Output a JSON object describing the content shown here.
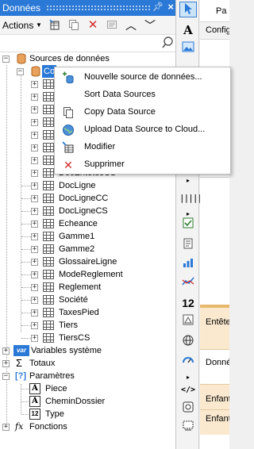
{
  "panel": {
    "title": "Données",
    "pin_icon": "pin-icon",
    "close_icon": "close-icon",
    "toolbar": {
      "actions_label": "Actions",
      "dropdown_icon": "caret-down-icon",
      "icons": [
        "new-datasource-icon",
        "copy-icon",
        "delete-icon",
        "properties-icon",
        "chevron-up-icon",
        "chevron-down-icon"
      ]
    },
    "search": {
      "value": "",
      "placeholder": ""
    },
    "tree": {
      "root": "Sources de données",
      "selected_partial": "Co",
      "tables": [
        "DocLigne",
        "DocLigneCC",
        "DocLigneCS",
        "Echeance",
        "Gamme1",
        "Gamme2",
        "GlossaireLigne",
        "ModeReglement",
        "Reglement",
        "Société",
        "TaxesPied",
        "Tiers",
        "TiersCS"
      ],
      "partial_hidden": "DocEntetesCS",
      "variables": "Variables système",
      "totals": "Totaux",
      "params": "Paramètres",
      "param_items": [
        {
          "label": "Piece",
          "icon": "text-param-icon"
        },
        {
          "label": "CheminDossier",
          "icon": "text-param-icon"
        },
        {
          "label": "Type",
          "icon": "number-param-icon"
        }
      ],
      "functions": "Fonctions"
    }
  },
  "context_menu": {
    "items": [
      {
        "label": "Nouvelle source de données...",
        "icon": "new-datasource-icon"
      },
      {
        "label": "Sort Data Sources",
        "icon": ""
      },
      {
        "label": "Copy Data Source",
        "icon": "copy-icon"
      },
      {
        "label": "Upload Data Source to Cloud...",
        "icon": "globe-icon"
      },
      {
        "label": "Modifier",
        "icon": "edit-icon"
      },
      {
        "label": "Supprimer",
        "icon": "delete-icon"
      }
    ]
  },
  "toolbox": {
    "tools": [
      "pointer-icon",
      "text-icon",
      "image-icon",
      "barcode-icon",
      "checkbox-icon",
      "report-icon",
      "bar-chart-icon",
      "line-chart-icon",
      "number-icon",
      "gauge-icon",
      "globe-icon",
      "speedometer-icon",
      "code-icon",
      "signature-icon",
      "shape-icon"
    ]
  },
  "page": {
    "tab_label": "Pa",
    "config_label": "Configu",
    "bands": [
      "Entête",
      "Donné",
      "Enfant",
      "Enfant"
    ]
  },
  "colors": {
    "accent": "#2b79d7",
    "delete": "#d22a2a",
    "band": "#f3d9b1"
  }
}
